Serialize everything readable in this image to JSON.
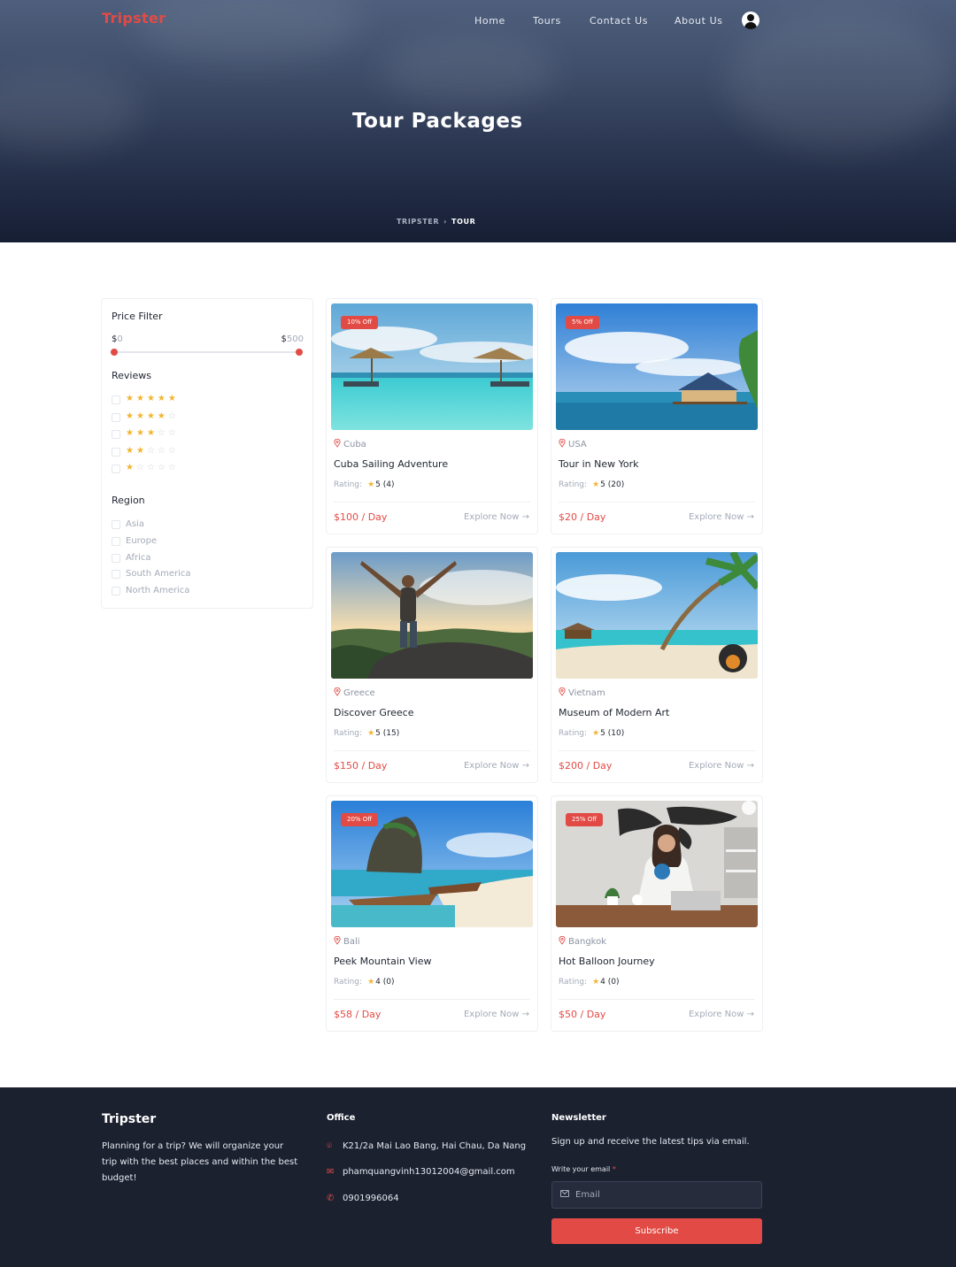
{
  "header": {
    "brand": "Tripster",
    "nav": [
      "Home",
      "Tours",
      "Contact Us",
      "About Us"
    ],
    "title": "Tour Packages",
    "breadcrumb": [
      "TRIPSTER",
      "TOUR"
    ]
  },
  "sidebar": {
    "price_title": "Price Filter",
    "price_min_symbol": "$",
    "price_min": "0",
    "price_max_symbol": "$",
    "price_max": "500",
    "price_range": [
      0,
      500
    ],
    "reviews_title": "Reviews",
    "reviews": [
      5,
      4,
      3,
      2,
      1
    ],
    "region_title": "Region",
    "regions": [
      "Asia",
      "Europe",
      "Africa",
      "South America",
      "North America"
    ]
  },
  "tours": [
    {
      "badge": "10% Off",
      "location": "Cuba",
      "title": "Cuba Sailing Adventure",
      "rating_label": "Rating:",
      "rating": "5 (4)",
      "price": "$100 / Day",
      "cta": "Explore Now →"
    },
    {
      "badge": "5% Off",
      "location": "USA",
      "title": "Tour in New York",
      "rating_label": "Rating:",
      "rating": "5 (20)",
      "price": "$20 / Day",
      "cta": "Explore Now →"
    },
    {
      "badge": "",
      "location": "Greece",
      "title": "Discover Greece",
      "rating_label": "Rating:",
      "rating": "5 (15)",
      "price": "$150 / Day",
      "cta": "Explore Now →"
    },
    {
      "badge": "",
      "location": "Vietnam",
      "title": "Museum of Modern Art",
      "rating_label": "Rating:",
      "rating": "5 (10)",
      "price": "$200 / Day",
      "cta": "Explore Now →"
    },
    {
      "badge": "20% Off",
      "location": "Bali",
      "title": "Peek Mountain View",
      "rating_label": "Rating:",
      "rating": "4 (0)",
      "price": "$58 / Day",
      "cta": "Explore Now →"
    },
    {
      "badge": "25% Off",
      "location": "Bangkok",
      "title": "Hot Balloon Journey",
      "rating_label": "Rating:",
      "rating": "4 (0)",
      "price": "$50 / Day",
      "cta": "Explore Now →"
    }
  ],
  "footer": {
    "brand": "Tripster",
    "desc": "Planning for a trip? We will organize your trip with the best places and within the best budget!",
    "office_title": "Office",
    "address": "K21/2a Mai Lao Bang, Hai Chau, Da Nang",
    "email": "phamquangvinh13012004@gmail.com",
    "phone": "0901996064",
    "newsletter_title": "Newsletter",
    "newsletter_text": "Sign up and receive the latest tips via email.",
    "email_label": "Write your email",
    "required_mark": "*",
    "email_placeholder": "Email",
    "subscribe": "Subscribe"
  },
  "colors": {
    "accent": "#e24b45",
    "star": "#f2b531",
    "footer_bg": "#1c2130",
    "hero_bg": "#2a3550"
  },
  "icons": [
    "user-avatar-icon",
    "chevron-right-icon",
    "map-pin-icon",
    "star-icon",
    "arrow-right-icon",
    "map-pin-icon",
    "mail-icon",
    "phone-icon"
  ]
}
